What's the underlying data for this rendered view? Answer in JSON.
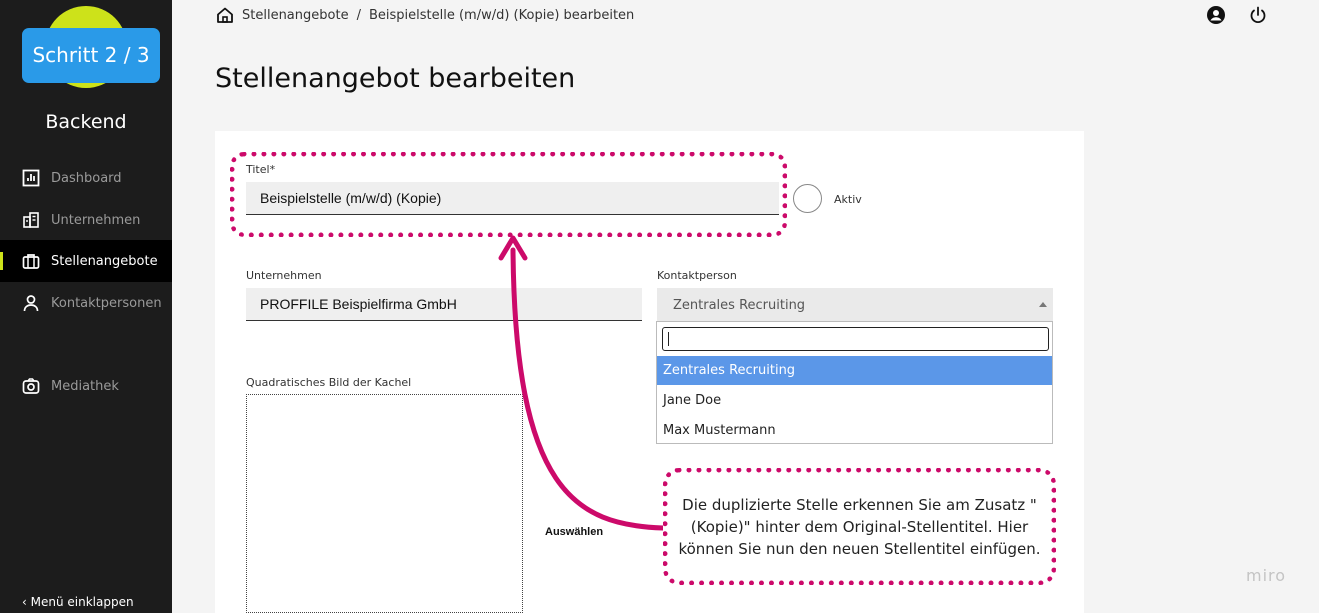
{
  "sidebar": {
    "step_badge": "Schritt 2 / 3",
    "brand": "Backend",
    "items": [
      {
        "label": "Dashboard",
        "icon": "chart-icon"
      },
      {
        "label": "Unternehmen",
        "icon": "building-icon"
      },
      {
        "label": "Stellenangebote",
        "icon": "briefcase-icon",
        "active": true
      },
      {
        "label": "Kontaktpersonen",
        "icon": "person-icon"
      },
      {
        "label": "Mediathek",
        "icon": "camera-icon"
      }
    ],
    "collapse_label": "Menü einklappen",
    "collapse_icon": "chevron-left-icon"
  },
  "header": {
    "breadcrumb": [
      "Stellenangebote",
      "/",
      "Beispielstelle (m/w/d) (Kopie) bearbeiten"
    ],
    "icons": [
      "home-icon",
      "account-icon",
      "power-icon"
    ]
  },
  "page_title": "Stellenangebot bearbeiten",
  "form": {
    "title_label": "Titel*",
    "title_value": "Beispielstelle (m/w/d) (Kopie)",
    "active_label": "Aktiv",
    "company_label": "Unternehmen",
    "company_value": "PROFFILE Beispielfirma GmbH",
    "contact_label": "Kontaktperson",
    "contact_value": "Zentrales Recruiting",
    "contact_options": [
      "Zentrales Recruiting",
      "Jane Doe",
      "Max Mustermann"
    ],
    "image_label": "Quadratisches Bild der Kachel",
    "image_select": "Auswählen"
  },
  "annotation": {
    "callout_text": "Die duplizierte Stelle erkennen Sie am Zusatz \"(Kopie)\" hinter dem Original-Stellentitel. Hier können Sie nun den neuen Stellentitel einfügen.",
    "color": "#cc0a6a"
  },
  "watermark": "miro",
  "colors": {
    "accent": "#cde21a",
    "badge": "#2a9ae8",
    "selected": "#5b97e8"
  }
}
